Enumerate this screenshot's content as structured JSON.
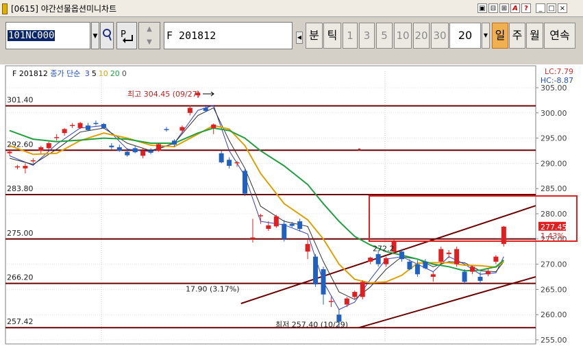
{
  "window": {
    "title": "[0615] 야간선물옵션미니차트",
    "controls": [
      "▣",
      "⊟",
      "⊞",
      "A",
      "?",
      "_",
      "□",
      "×"
    ]
  },
  "toolbar": {
    "code": "101NC000",
    "p_label": "P",
    "name": "F 201812",
    "period_buttons": [
      {
        "label": "분",
        "dim": false,
        "selected": false
      },
      {
        "label": "틱",
        "dim": false,
        "selected": false
      },
      {
        "label": "1",
        "dim": true,
        "selected": false
      },
      {
        "label": "3",
        "dim": true,
        "selected": false
      },
      {
        "label": "5",
        "dim": true,
        "selected": false
      },
      {
        "label": "10",
        "dim": true,
        "selected": false
      },
      {
        "label": "20",
        "dim": true,
        "selected": false
      },
      {
        "label": "30",
        "dim": true,
        "selected": false
      }
    ],
    "period_value": "20",
    "range_buttons": [
      {
        "label": "일",
        "selected": true
      },
      {
        "label": "주",
        "selected": false
      },
      {
        "label": "월",
        "selected": false
      },
      {
        "label": "연속",
        "selected": false
      }
    ]
  },
  "chart": {
    "legend": {
      "symbol": "F 201812",
      "indicator": "종가 단순",
      "ma": [
        {
          "label": "3",
          "color": "#3040c0"
        },
        {
          "label": "5",
          "color": "#000000"
        },
        {
          "label": "10",
          "color": "#e0a000"
        },
        {
          "label": "20",
          "color": "#20a040"
        },
        {
          "label": "0",
          "color": "#505050"
        }
      ]
    },
    "lc": "LC:7.79",
    "hc": "HC:-8.87",
    "level_labels": [
      "301.40",
      "292.60",
      "283.80",
      "275.00",
      "266.20",
      "257.42"
    ],
    "high_note": "최고 304.45 (09/27)",
    "low_note": "최저 257.40 (10/29)",
    "channel_note": "17.90 (3.17%)",
    "mid_note": "272.2",
    "current_price": "277.45",
    "current_change": "1.43%",
    "highlight_color": "#e02020",
    "up_color": "#e02020",
    "down_color": "#2060c0"
  },
  "chart_data": {
    "type": "candlestick",
    "y_axis": {
      "range": [
        255,
        305
      ],
      "ticks": [
        "305.00",
        "300.00",
        "295.00",
        "290.00",
        "285.00",
        "280.00",
        "275.00",
        "270.00",
        "265.00",
        "260.00",
        "255.00"
      ]
    },
    "horizontal_levels": [
      301.4,
      292.6,
      283.8,
      275.0,
      266.2,
      257.42
    ],
    "candles": [
      {
        "o": 292.0,
        "h": 292.8,
        "l": 291.5,
        "c": 292.3
      },
      {
        "o": 289.2,
        "h": 289.7,
        "l": 288.8,
        "c": 289.4
      },
      {
        "o": 289.0,
        "h": 290.0,
        "l": 288.0,
        "c": 289.5
      },
      {
        "o": 290.5,
        "h": 291.0,
        "l": 290.0,
        "c": 290.6
      },
      {
        "o": 292.5,
        "h": 293.5,
        "l": 292.0,
        "c": 293.2
      },
      {
        "o": 293.0,
        "h": 294.3,
        "l": 292.7,
        "c": 294.0
      },
      {
        "o": 295.0,
        "h": 295.8,
        "l": 294.5,
        "c": 295.2
      },
      {
        "o": 296.0,
        "h": 297.0,
        "l": 295.5,
        "c": 296.8
      },
      {
        "o": 297.5,
        "h": 298.0,
        "l": 297.0,
        "c": 297.6
      },
      {
        "o": 297.0,
        "h": 298.2,
        "l": 296.8,
        "c": 298.0
      },
      {
        "o": 297.5,
        "h": 298.0,
        "l": 296.5,
        "c": 296.6
      },
      {
        "o": 298.0,
        "h": 298.5,
        "l": 297.5,
        "c": 297.8
      },
      {
        "o": 297.8,
        "h": 298.0,
        "l": 296.8,
        "c": 297.0
      },
      {
        "o": 293.5,
        "h": 294.0,
        "l": 292.8,
        "c": 293.2
      },
      {
        "o": 293.2,
        "h": 293.7,
        "l": 292.3,
        "c": 292.5
      },
      {
        "o": 292.3,
        "h": 293.0,
        "l": 291.3,
        "c": 291.6
      },
      {
        "o": 293.0,
        "h": 293.5,
        "l": 292.0,
        "c": 292.2
      },
      {
        "o": 291.5,
        "h": 293.0,
        "l": 291.0,
        "c": 292.5
      },
      {
        "o": 292.5,
        "h": 293.0,
        "l": 291.8,
        "c": 292.1
      },
      {
        "o": 292.5,
        "h": 294.0,
        "l": 292.3,
        "c": 293.8
      },
      {
        "o": 296.8,
        "h": 297.2,
        "l": 296.3,
        "c": 296.7
      },
      {
        "o": 294.5,
        "h": 294.8,
        "l": 293.3,
        "c": 293.7
      },
      {
        "o": 296.5,
        "h": 297.5,
        "l": 296.0,
        "c": 297.2
      },
      {
        "o": 300.0,
        "h": 301.5,
        "l": 299.5,
        "c": 301.0
      },
      {
        "o": 303.5,
        "h": 304.45,
        "l": 303.0,
        "c": 304.0
      },
      {
        "o": 301.0,
        "h": 301.6,
        "l": 300.2,
        "c": 300.4
      },
      {
        "o": 297.0,
        "h": 297.9,
        "l": 295.8,
        "c": 297.7
      },
      {
        "o": 292.0,
        "h": 292.5,
        "l": 290.0,
        "c": 290.2
      },
      {
        "o": 290.7,
        "h": 291.2,
        "l": 289.0,
        "c": 289.5
      },
      {
        "o": 290.0,
        "h": 290.5,
        "l": 289.3,
        "c": 290.2
      },
      {
        "o": 288.5,
        "h": 289.0,
        "l": 283.5,
        "c": 284.0
      },
      {
        "o": 275.0,
        "h": 279.0,
        "l": 274.3,
        "c": 275.3
      },
      {
        "o": 279.5,
        "h": 280.0,
        "l": 278.0,
        "c": 279.7
      },
      {
        "o": 277.0,
        "h": 278.5,
        "l": 276.6,
        "c": 277.7
      },
      {
        "o": 277.5,
        "h": 279.8,
        "l": 277.2,
        "c": 279.5
      },
      {
        "o": 278.0,
        "h": 278.8,
        "l": 274.5,
        "c": 275.0
      },
      {
        "o": 278.0,
        "h": 278.4,
        "l": 277.3,
        "c": 277.6
      },
      {
        "o": 278.5,
        "h": 279.0,
        "l": 276.5,
        "c": 277.0
      },
      {
        "o": 272.5,
        "h": 275.0,
        "l": 271.0,
        "c": 274.0
      },
      {
        "o": 271.5,
        "h": 272.0,
        "l": 265.5,
        "c": 266.0
      },
      {
        "o": 269.0,
        "h": 269.5,
        "l": 262.0,
        "c": 264.0
      },
      {
        "o": 262.5,
        "h": 263.5,
        "l": 261.5,
        "c": 262.7
      },
      {
        "o": 260.0,
        "h": 261.0,
        "l": 257.4,
        "c": 258.6
      },
      {
        "o": 262.0,
        "h": 263.5,
        "l": 261.5,
        "c": 263.2
      },
      {
        "o": 263.5,
        "h": 264.8,
        "l": 263.0,
        "c": 264.5
      },
      {
        "o": 263.5,
        "h": 266.8,
        "l": 263.0,
        "c": 266.5
      },
      {
        "o": 270.5,
        "h": 271.5,
        "l": 270.0,
        "c": 271.3
      },
      {
        "o": 272.0,
        "h": 272.8,
        "l": 269.5,
        "c": 270.0
      },
      {
        "o": 270.0,
        "h": 271.5,
        "l": 269.5,
        "c": 271.2
      },
      {
        "o": 272.5,
        "h": 275.0,
        "l": 272.0,
        "c": 274.5
      },
      {
        "o": 272.5,
        "h": 273.0,
        "l": 270.5,
        "c": 271.0
      },
      {
        "o": 270.5,
        "h": 271.0,
        "l": 268.8,
        "c": 269.0
      },
      {
        "o": 270.0,
        "h": 270.8,
        "l": 267.5,
        "c": 268.0
      },
      {
        "o": 270.5,
        "h": 271.0,
        "l": 269.0,
        "c": 269.2
      },
      {
        "o": 267.5,
        "h": 268.5,
        "l": 266.5,
        "c": 268.0
      },
      {
        "o": 270.5,
        "h": 273.5,
        "l": 270.0,
        "c": 273.0
      },
      {
        "o": 272.0,
        "h": 272.8,
        "l": 271.2,
        "c": 272.3
      },
      {
        "o": 270.0,
        "h": 273.5,
        "l": 269.5,
        "c": 273.0
      },
      {
        "o": 268.5,
        "h": 269.0,
        "l": 266.0,
        "c": 266.5
      },
      {
        "o": 268.5,
        "h": 269.7,
        "l": 268.0,
        "c": 269.5
      },
      {
        "o": 267.5,
        "h": 268.5,
        "l": 266.0,
        "c": 266.7
      },
      {
        "o": 268.0,
        "h": 269.0,
        "l": 267.6,
        "c": 268.6
      },
      {
        "o": 270.5,
        "h": 271.8,
        "l": 270.0,
        "c": 271.5
      },
      {
        "o": 274.0,
        "h": 277.6,
        "l": 273.5,
        "c": 277.45
      }
    ],
    "moving_averages": [
      {
        "period": "3",
        "color": "#3040c0",
        "points": [
          [
            0,
            291.5
          ],
          [
            3,
            289.6
          ],
          [
            6,
            293.8
          ],
          [
            9,
            297.0
          ],
          [
            12,
            297.5
          ],
          [
            15,
            292.8
          ],
          [
            18,
            292.3
          ],
          [
            21,
            294.0
          ],
          [
            24,
            300.5
          ],
          [
            26,
            301.5
          ],
          [
            28,
            292.5
          ],
          [
            30,
            287.5
          ],
          [
            32,
            278.5
          ],
          [
            35,
            277.8
          ],
          [
            38,
            276.0
          ],
          [
            40,
            266.5
          ],
          [
            42,
            261.0
          ],
          [
            44,
            262.5
          ],
          [
            46,
            267.0
          ],
          [
            48,
            271.0
          ],
          [
            50,
            271.5
          ],
          [
            52,
            270.0
          ],
          [
            54,
            268.5
          ],
          [
            56,
            271.5
          ],
          [
            58,
            270.0
          ],
          [
            60,
            268.0
          ],
          [
            62,
            268.3
          ],
          [
            63,
            271.5
          ]
        ]
      },
      {
        "period": "5",
        "color": "#303030",
        "points": [
          [
            0,
            291.0
          ],
          [
            3,
            289.8
          ],
          [
            6,
            292.8
          ],
          [
            9,
            296.2
          ],
          [
            12,
            297.0
          ],
          [
            15,
            294.0
          ],
          [
            18,
            292.5
          ],
          [
            21,
            294.0
          ],
          [
            24,
            299.5
          ],
          [
            26,
            301.0
          ],
          [
            28,
            294.5
          ],
          [
            30,
            289.0
          ],
          [
            32,
            281.5
          ],
          [
            35,
            278.5
          ],
          [
            38,
            277.5
          ],
          [
            40,
            270.5
          ],
          [
            42,
            264.5
          ],
          [
            44,
            263.0
          ],
          [
            46,
            265.5
          ],
          [
            48,
            269.0
          ],
          [
            50,
            271.5
          ],
          [
            52,
            271.0
          ],
          [
            54,
            269.5
          ],
          [
            56,
            270.5
          ],
          [
            58,
            270.3
          ],
          [
            60,
            268.7
          ],
          [
            62,
            268.5
          ],
          [
            63,
            270.5
          ]
        ]
      },
      {
        "period": "10",
        "color": "#e0a000",
        "points": [
          [
            0,
            293.5
          ],
          [
            3,
            291.8
          ],
          [
            6,
            292.0
          ],
          [
            9,
            294.5
          ],
          [
            12,
            296.0
          ],
          [
            15,
            295.0
          ],
          [
            18,
            293.6
          ],
          [
            21,
            293.3
          ],
          [
            24,
            295.8
          ],
          [
            26,
            297.5
          ],
          [
            28,
            296.8
          ],
          [
            30,
            293.5
          ],
          [
            32,
            288.0
          ],
          [
            35,
            282.0
          ],
          [
            38,
            278.8
          ],
          [
            40,
            275.0
          ],
          [
            42,
            270.0
          ],
          [
            44,
            267.0
          ],
          [
            46,
            266.3
          ],
          [
            48,
            266.5
          ],
          [
            50,
            267.8
          ],
          [
            52,
            270.2
          ],
          [
            54,
            270.3
          ],
          [
            56,
            270.3
          ],
          [
            58,
            269.8
          ],
          [
            60,
            269.7
          ],
          [
            62,
            269.4
          ],
          [
            63,
            270.5
          ]
        ]
      },
      {
        "period": "20",
        "color": "#20a040",
        "points": [
          [
            0,
            296.5
          ],
          [
            3,
            294.8
          ],
          [
            6,
            294.3
          ],
          [
            9,
            294.6
          ],
          [
            12,
            295.0
          ],
          [
            15,
            294.8
          ],
          [
            18,
            294.0
          ],
          [
            21,
            294.0
          ],
          [
            24,
            296.0
          ],
          [
            26,
            297.0
          ],
          [
            28,
            296.5
          ],
          [
            30,
            295.0
          ],
          [
            32,
            292.5
          ],
          [
            35,
            289.5
          ],
          [
            38,
            285.8
          ],
          [
            40,
            282.0
          ],
          [
            42,
            278.5
          ],
          [
            44,
            275.5
          ],
          [
            46,
            273.8
          ],
          [
            48,
            272.5
          ],
          [
            50,
            271.8
          ],
          [
            52,
            271.0
          ],
          [
            54,
            270.0
          ],
          [
            56,
            269.5
          ],
          [
            58,
            268.7
          ],
          [
            60,
            268.8
          ],
          [
            62,
            269.5
          ],
          [
            63,
            270.8
          ]
        ]
      }
    ]
  }
}
